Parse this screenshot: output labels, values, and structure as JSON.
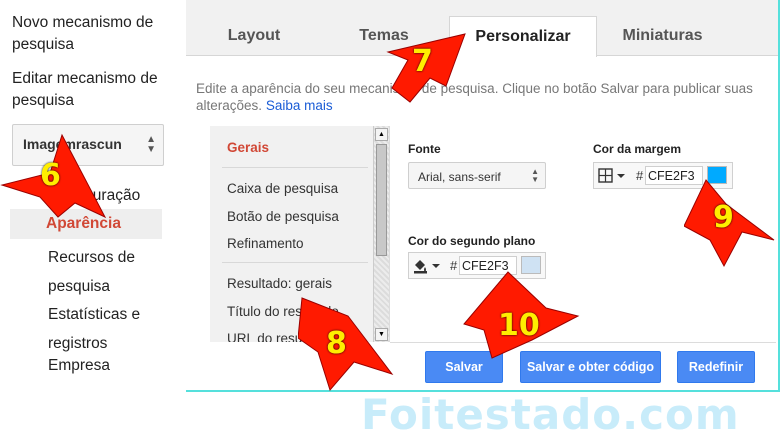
{
  "sidebar": {
    "links": [
      "Novo mecanismo de pesquisa",
      "Editar mecanismo de pesquisa"
    ],
    "engine_selector": "Imagemrascun",
    "items": [
      "Configuração",
      "Aparência",
      "Recursos de pesquisa",
      "Estatísticas e registros",
      "Empresa"
    ],
    "active_item": "Aparência"
  },
  "tabs": [
    "Layout",
    "Temas",
    "Personalizar",
    "Miniaturas"
  ],
  "active_tab": "Personalizar",
  "description": {
    "text": "Edite a aparência do seu mecanismo de pesquisa. Clique no botão Salvar para publicar suas alterações.",
    "link": "Saiba mais"
  },
  "subnav": {
    "items": [
      "Gerais",
      "Caixa de pesquisa",
      "Botão de pesquisa",
      "Refinamento",
      "Resultado: gerais",
      "Título do resultado",
      "URL do resultado"
    ],
    "active": "Gerais"
  },
  "form": {
    "font_label": "Fonte",
    "font_value": "Arial, sans-serif",
    "border_color_label": "Cor da margem",
    "border_color_hex": "CFE2F3",
    "border_swatch_color": "#00aaff",
    "background_color_label": "Cor do segundo plano",
    "background_color_hex": "CFE2F3",
    "background_swatch_color": "#cfe2f3",
    "hash": "#"
  },
  "buttons": {
    "save": "Salvar",
    "save_get_code": "Salvar e obter código",
    "reset": "Redefinir"
  },
  "annotations": [
    {
      "number": "6",
      "color": "#ff0000"
    },
    {
      "number": "7",
      "color": "#ff0000"
    },
    {
      "number": "8",
      "color": "#ff0000"
    },
    {
      "number": "9",
      "color": "#ff0000"
    },
    {
      "number": "10",
      "color": "#ff0000"
    }
  ],
  "watermark": "Foitestado.com"
}
